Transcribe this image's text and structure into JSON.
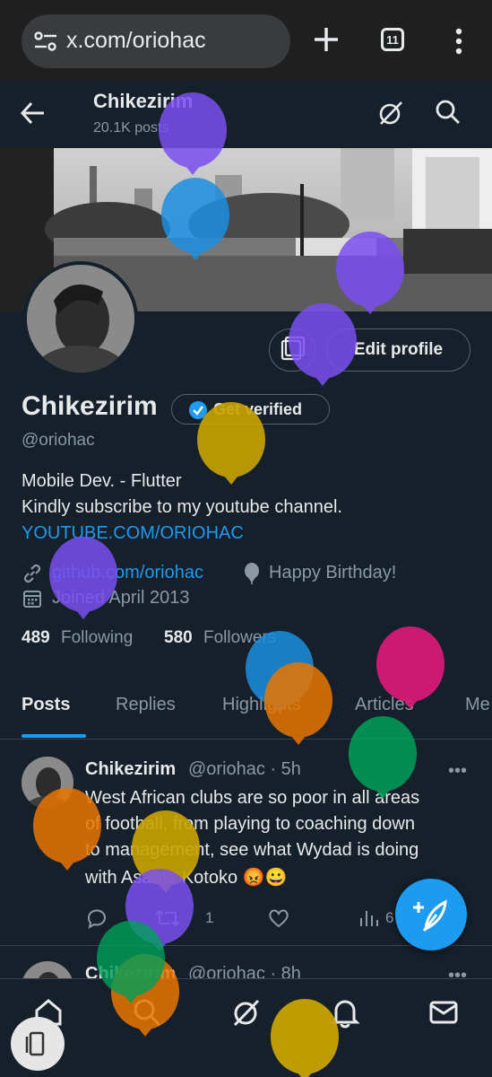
{
  "browser": {
    "url": "x.com/oriohac",
    "tab_count": "11"
  },
  "header": {
    "title": "Chikezirim",
    "post_count": "20.1K posts"
  },
  "profile": {
    "edit_label": "Edit profile",
    "name": "Chikezirim",
    "get_verified": "Get verified",
    "handle": "@oriohac",
    "bio_line1": "Mobile Dev. - Flutter",
    "bio_line2": "Kindly subscribe to my youtube channel.",
    "bio_link": "YOUTUBE.COM/ORIOHAC",
    "website": "github.com/oriohac",
    "birthday": "Happy Birthday!",
    "joined": "Joined April 2013",
    "following_count": "489",
    "following_label": "Following",
    "followers_count": "580",
    "followers_label": "Followers"
  },
  "tabs": [
    {
      "label": "Posts"
    },
    {
      "label": "Replies"
    },
    {
      "label": "Highlights"
    },
    {
      "label": "Articles"
    },
    {
      "label": "Me"
    }
  ],
  "posts": [
    {
      "name": "Chikezirim",
      "handle_time": "@oriohac · 5h",
      "lines": [
        "West African clubs are so poor in all areas",
        "of football, from playing to coaching down",
        "to management, see what Wydad is doing",
        "with Asante Kotoko 😡😀"
      ],
      "retweets": "1",
      "views": "6"
    },
    {
      "name": "Chikezirim",
      "handle_time": "@oriohac · 8h"
    }
  ],
  "icons": {
    "verified": "verified-badge-icon",
    "compose": "compose-post-icon"
  },
  "colors": {
    "background": "#15202b",
    "accent": "#1d9bf0",
    "muted": "#8b98a5",
    "balloons": [
      "#7b4ff0",
      "#1d8fe0",
      "#c9a400",
      "#e0197a",
      "#00a05a",
      "#e87500"
    ]
  }
}
